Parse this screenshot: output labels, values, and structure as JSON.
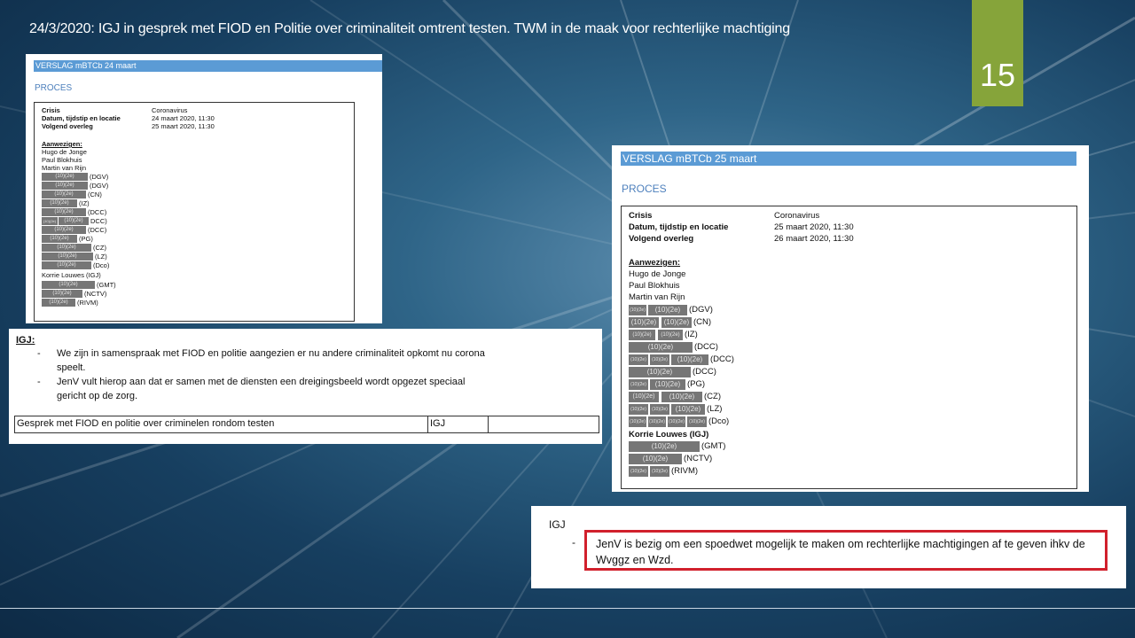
{
  "slide": {
    "title": "24/3/2020: IGJ in gesprek met FIOD en Politie over criminaliteit omtrent testen. TWM in de maak voor rechterlijke machtiging",
    "page_number": "15",
    "accent_color": "#86a43a",
    "highlight_color": "#d1202c"
  },
  "doc_a": {
    "header": "VERSLAG mBTCb 24 maart",
    "section": "PROCES",
    "info": [
      {
        "key": "Crisis",
        "value": "Coronavirus"
      },
      {
        "key": "Datum, tijdstip en locatie",
        "value": "24 maart 2020, 11:30"
      },
      {
        "key": "Volgend overleg",
        "value": "25 maart 2020, 11:30"
      }
    ],
    "attendees_title": "Aanwezigen:",
    "attendees": [
      "Hugo de Jonge",
      "Paul Blokhuis",
      "Martin van Rijn"
    ],
    "redacted_rows": [
      {
        "codes": [
          "(10)(2e)"
        ],
        "label": "(DGV)"
      },
      {
        "codes": [
          "(10)(2e)"
        ],
        "label": "(DGV)"
      },
      {
        "codes": [
          "(10)(2e)"
        ],
        "label": "(CN)"
      },
      {
        "codes": [
          "(10)(2e)"
        ],
        "label": "(IZ)"
      },
      {
        "codes": [
          "(10)(2e)"
        ],
        "label": "(DCC)"
      },
      {
        "codes": [
          "(10)(2e)",
          "(10)(2e)"
        ],
        "label": "DCC)"
      },
      {
        "codes": [
          "(10)(2e)"
        ],
        "label": "(DCC)"
      },
      {
        "codes": [
          "(10)(2e)"
        ],
        "label": "(PG)"
      },
      {
        "codes": [
          "(10)(2e)"
        ],
        "label": "(CZ)"
      },
      {
        "codes": [
          "(10)(2e)"
        ],
        "label": "(LZ)"
      },
      {
        "codes": [
          "(10)(2e)"
        ],
        "label": "(Dco)"
      }
    ],
    "igj_attendee": "Korrie Louwes (IGJ)",
    "igj_rows": [
      {
        "codes": [
          "(10)(2e)"
        ],
        "label": "(GMT)"
      },
      {
        "codes": [
          "(10)(2e)"
        ],
        "label": "(NCTV)"
      },
      {
        "codes": [
          "(10)(2e)"
        ],
        "label": "(RIVM)"
      }
    ]
  },
  "doc_b": {
    "heading": "IGJ:",
    "bullets": [
      "We zijn in samenspraak met FIOD en politie aangezien er nu andere criminaliteit opkomt nu corona speelt.",
      "JenV vult hierop aan dat er samen met de diensten een dreigingsbeeld wordt opgezet speciaal gericht op de zorg."
    ],
    "action_row": {
      "topic": "Gesprek met FIOD en politie over criminelen rondom testen",
      "owner": "IGJ"
    }
  },
  "doc_c": {
    "header": "VERSLAG mBTCb 25 maart",
    "section": "PROCES",
    "info": [
      {
        "key": "Crisis",
        "value": "Coronavirus"
      },
      {
        "key": "Datum, tijdstip en locatie",
        "value": "25 maart 2020, 11:30"
      },
      {
        "key": "Volgend overleg",
        "value": "26 maart 2020, 11:30"
      }
    ],
    "attendees_title": "Aanwezigen:",
    "attendees": [
      "Hugo de Jonge",
      "Paul Blokhuis",
      "Martin van Rijn"
    ],
    "redacted_rows": [
      {
        "codes": [
          "(10)(2e)",
          "(10)(2e)"
        ],
        "label": "(DGV)"
      },
      {
        "codes": [
          "(10)(2e)",
          "(10)(2e)"
        ],
        "label": "(CN)"
      },
      {
        "codes": [
          "(10)(2e)",
          "(10)(2e)"
        ],
        "label": "(IZ)"
      },
      {
        "codes": [
          "(10)(2e)"
        ],
        "label": "(DCC)"
      },
      {
        "codes": [
          "(10)(2e)",
          "(10)(2e)",
          "(10)(2e)"
        ],
        "label": "(DCC)"
      },
      {
        "codes": [
          "(10)(2e)"
        ],
        "label": "(DCC)"
      },
      {
        "codes": [
          "(10)(2e)",
          "(10)(2e)"
        ],
        "label": "(PG)"
      },
      {
        "codes": [
          "(10)(2e)",
          "(10)(2e)"
        ],
        "label": "(CZ)"
      },
      {
        "codes": [
          "(10)(2e)",
          "(10)(2e)",
          "(10)(2e)"
        ],
        "label": "(LZ)"
      },
      {
        "codes": [
          "(10)(2e)",
          "(10)(2e)",
          "(10)(2e)",
          "(10)(2e)"
        ],
        "label": "(Dco)"
      }
    ],
    "igj_attendee": "Korrie Louwes (IGJ)",
    "igj_rows": [
      {
        "codes": [
          "(10)(2e)"
        ],
        "label": "(GMT)"
      },
      {
        "codes": [
          "(10)(2e)"
        ],
        "label": "(NCTV)"
      },
      {
        "codes": [
          "(10)(2e)",
          "(10)(2e)"
        ],
        "label": "(RIVM)"
      }
    ]
  },
  "doc_d": {
    "heading": "IGJ",
    "bullet": "JenV is bezig om een spoedwet mogelijk te maken om rechterlijke machtigingen af te geven ihkv de Wvggz en Wzd."
  }
}
